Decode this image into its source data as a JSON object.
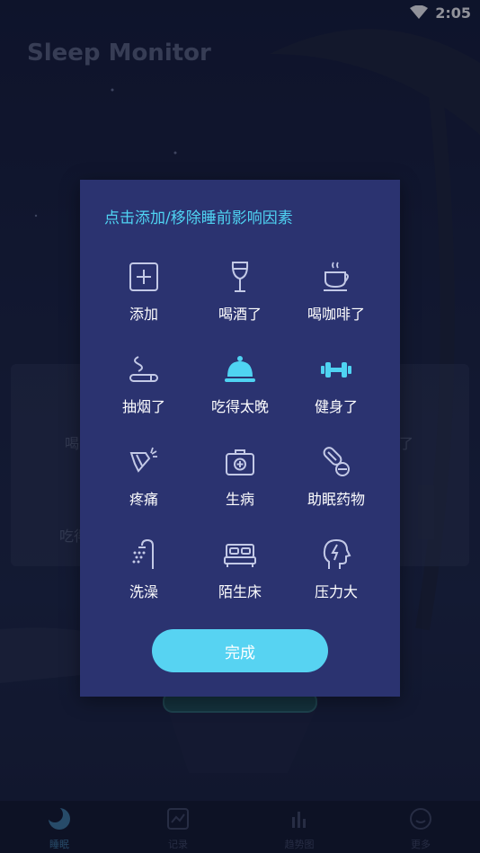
{
  "status_bar": {
    "time": "2:05"
  },
  "app": {
    "title": "Sleep Monitor"
  },
  "dialog": {
    "title": "点击添加/移除睡前影响因素",
    "factors": [
      {
        "label": "添加",
        "icon": "plus-box-icon",
        "selected": false
      },
      {
        "label": "喝酒了",
        "icon": "wine-glass-icon",
        "selected": false
      },
      {
        "label": "喝咖啡了",
        "icon": "coffee-cup-icon",
        "selected": false
      },
      {
        "label": "抽烟了",
        "icon": "smoking-icon",
        "selected": false
      },
      {
        "label": "吃得太晚",
        "icon": "food-cloche-icon",
        "selected": true
      },
      {
        "label": "健身了",
        "icon": "dumbbell-icon",
        "selected": true
      },
      {
        "label": "疼痛",
        "icon": "pain-icon",
        "selected": false
      },
      {
        "label": "生病",
        "icon": "first-aid-kit-icon",
        "selected": false
      },
      {
        "label": "助眠药物",
        "icon": "pills-icon",
        "selected": false
      },
      {
        "label": "洗澡",
        "icon": "shower-icon",
        "selected": false
      },
      {
        "label": "陌生床",
        "icon": "bed-icon",
        "selected": false
      },
      {
        "label": "压力大",
        "icon": "stress-head-icon",
        "selected": false
      }
    ],
    "done_label": "完成"
  },
  "background": {
    "partial_1": "喝",
    "partial_2": "吃得",
    "partial_3": "了"
  },
  "tabbar": {
    "tabs": [
      "睡眠",
      "记录",
      "趋势图",
      "更多"
    ]
  },
  "colors": {
    "accent": "#4fd3f2",
    "dialog_bg": "#2b3370",
    "button": "#57d3f2",
    "icon": "#c3c9e6"
  }
}
